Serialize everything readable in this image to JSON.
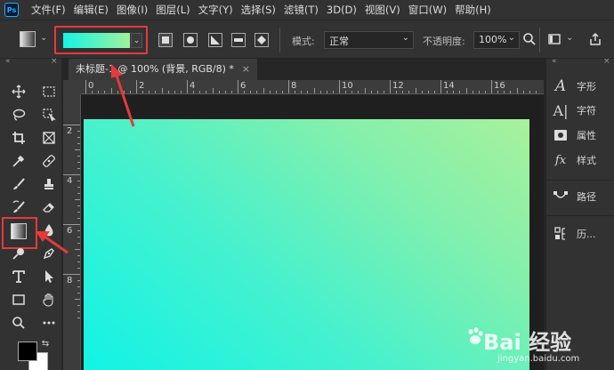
{
  "app": {
    "logo": "Ps"
  },
  "menu": [
    "文件(F)",
    "编辑(E)",
    "图像(I)",
    "图层(L)",
    "文字(Y)",
    "选择(S)",
    "滤镜(T)",
    "3D(D)",
    "视图(V)",
    "窗口(W)",
    "帮助(H)"
  ],
  "options": {
    "gradient_colors": [
      "#16f4e3",
      "#9ff29b"
    ],
    "mode_label": "模式:",
    "mode_value": "正常",
    "opacity_label": "不透明度:",
    "opacity_value": "100%"
  },
  "document": {
    "tab_title": "未标题-1 @ 100% (背景, RGB/8) *",
    "close_glyph": "×"
  },
  "rulers": {
    "top": [
      "0",
      "2",
      "4",
      "6",
      "8",
      "10",
      "12",
      "14",
      "16"
    ],
    "left": [
      "2",
      "4",
      "6",
      "8"
    ]
  },
  "panels": [
    {
      "icon": "character-icon",
      "label": "字形"
    },
    {
      "icon": "type-icon",
      "label": "字符"
    },
    {
      "icon": "properties-icon",
      "label": "属性"
    },
    {
      "icon": "styles-icon",
      "label": "样式"
    },
    {
      "icon": "paths-icon",
      "label": "路径"
    },
    {
      "icon": "history-icon",
      "label": "历..."
    }
  ],
  "colors": {
    "foreground": "#000000",
    "background": "#ffffff",
    "highlight": "#e63a3a"
  },
  "watermark": {
    "text": "Bai 经验",
    "sub": "jingyan.baidu.com"
  }
}
